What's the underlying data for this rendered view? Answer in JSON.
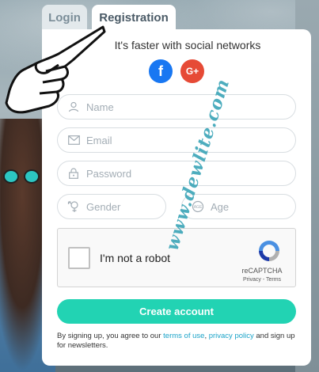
{
  "tabs": {
    "login": "Login",
    "registration": "Registration"
  },
  "social": {
    "title": "It's faster with social networks",
    "facebook_glyph": "f",
    "google_glyph": "G+",
    "facebook_color": "#1877f2",
    "google_color": "#e64a36"
  },
  "form": {
    "name_placeholder": "Name",
    "email_placeholder": "Email",
    "password_placeholder": "Password",
    "gender_placeholder": "Gender",
    "age_placeholder": "Age"
  },
  "captcha": {
    "label": "I'm not a robot",
    "brand": "reCAPTCHA",
    "links": "Privacy - Terms"
  },
  "submit_label": "Create account",
  "terms": {
    "prefix": "By signing up, you agree to our ",
    "terms_link": "terms of use",
    "separator": ", ",
    "privacy_link": "privacy policy",
    "suffix": " and sign up for newsletters."
  },
  "watermark": "www.dewlite.com",
  "accent_color": "#22d3b3",
  "icons": [
    "user-icon",
    "envelope-icon",
    "lock-icon",
    "gender-icon",
    "age-icon",
    "hand-pointer-icon",
    "recaptcha-icon"
  ]
}
